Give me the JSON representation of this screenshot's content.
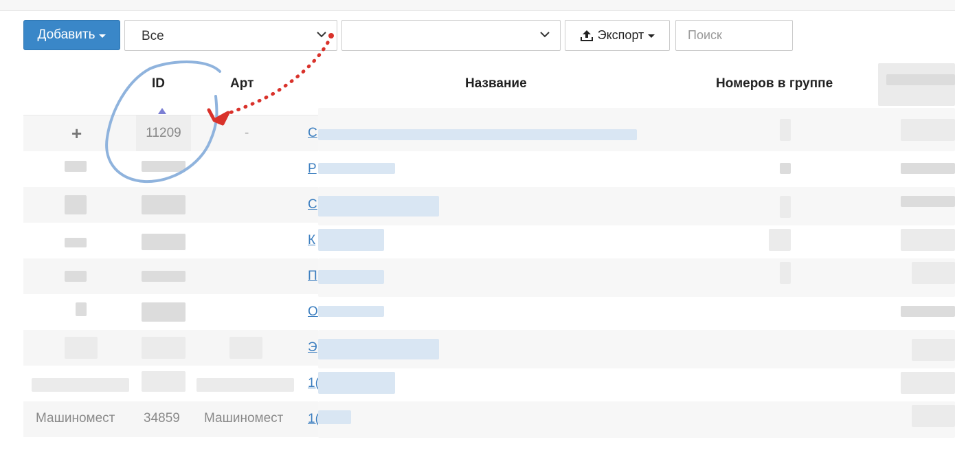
{
  "toolbar": {
    "add_label": "Добавить",
    "filter1_value": "Все",
    "filter2_value": "",
    "export_label": "Экспорт",
    "search_placeholder": "Поиск"
  },
  "table": {
    "headers": {
      "id": "ID",
      "art": "Арт",
      "name": "Название",
      "count": "Номеров в группе"
    },
    "sort": {
      "column": "ID",
      "direction": "ascending"
    },
    "first_row": {
      "expand": "+",
      "id": "11209",
      "art": "-",
      "name_start": "С"
    },
    "visible_name_starts": [
      "С",
      "Р",
      "С",
      "К",
      "П",
      "О",
      "Э",
      "1(",
      "1("
    ],
    "last_row": {
      "col1": "Машиномест",
      "id": "34859",
      "art": "Машиномест",
      "name_start": "1("
    }
  },
  "icons": [
    "chevron-down-icon",
    "upload-icon",
    "caret-down-icon",
    "sort-asc-icon",
    "plus-icon"
  ],
  "colors": {
    "primary": "#3a87c8",
    "link": "#3d7fc0",
    "annotation_circle": "#8fb3dd",
    "annotation_arrow": "#d9322b"
  }
}
